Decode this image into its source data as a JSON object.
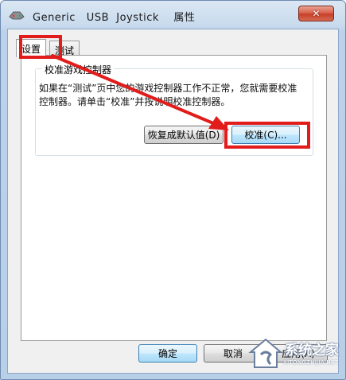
{
  "window": {
    "title": "Generic   USB  Joystick    属性",
    "close_symbol": "✕"
  },
  "tabs": [
    {
      "label": "设置",
      "active": true
    },
    {
      "label": "测试",
      "active": false
    }
  ],
  "settings": {
    "group_title": "校准游戏控制器",
    "description": "如果在“测试”页中您的游戏控制器工作不正常，您就需要校准控制器。请单击“校准”并按说明校准控制器。",
    "restore_defaults_button": "恢复成默认值(D)",
    "calibrate_button": "校准(C)..."
  },
  "footer": {
    "ok_button": "确定",
    "cancel_button": "取消",
    "apply_button": "应用(A)"
  },
  "watermark": {
    "text": "系统之家",
    "url": "XITONGZHIJIA.NET"
  },
  "annotation": {
    "highlight_color": "#e21b1b"
  }
}
